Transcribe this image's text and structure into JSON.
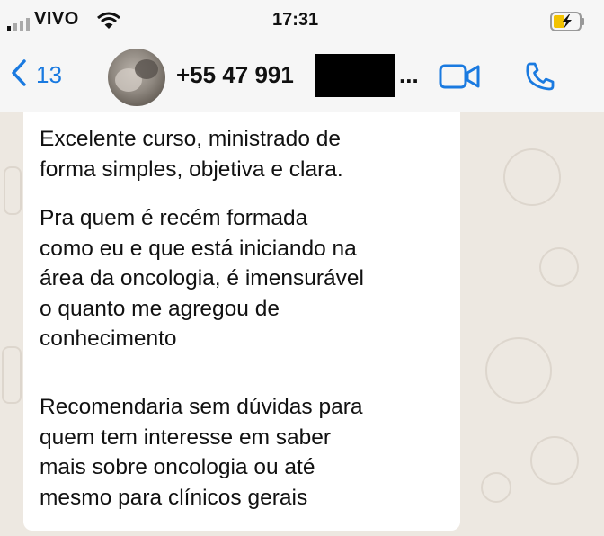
{
  "status_bar": {
    "carrier": "VIVO",
    "time": "17:31"
  },
  "nav": {
    "back_count": "13",
    "contact_name": "+55 47 991",
    "ellipsis": "..."
  },
  "message": {
    "paragraphs": [
      [
        "Excelente curso, ministrado de",
        "forma simples, objetiva e clara."
      ],
      [
        "Pra quem é recém formada",
        "como eu e que está iniciando na",
        "área da oncologia, é imensurável",
        "o quanto me agregou de",
        "conhecimento"
      ],
      [
        "Recomendaria sem dúvidas para",
        "quem tem interesse em saber",
        "mais sobre oncologia ou até",
        "mesmo para clínicos gerais"
      ]
    ]
  },
  "colors": {
    "accent": "#1a7ae0",
    "chat_background": "#ede8e1",
    "bubble": "#ffffff"
  },
  "icons": [
    "signal-icon",
    "wifi-icon",
    "battery-charging-icon",
    "back-chevron-icon",
    "video-call-icon",
    "phone-icon"
  ]
}
